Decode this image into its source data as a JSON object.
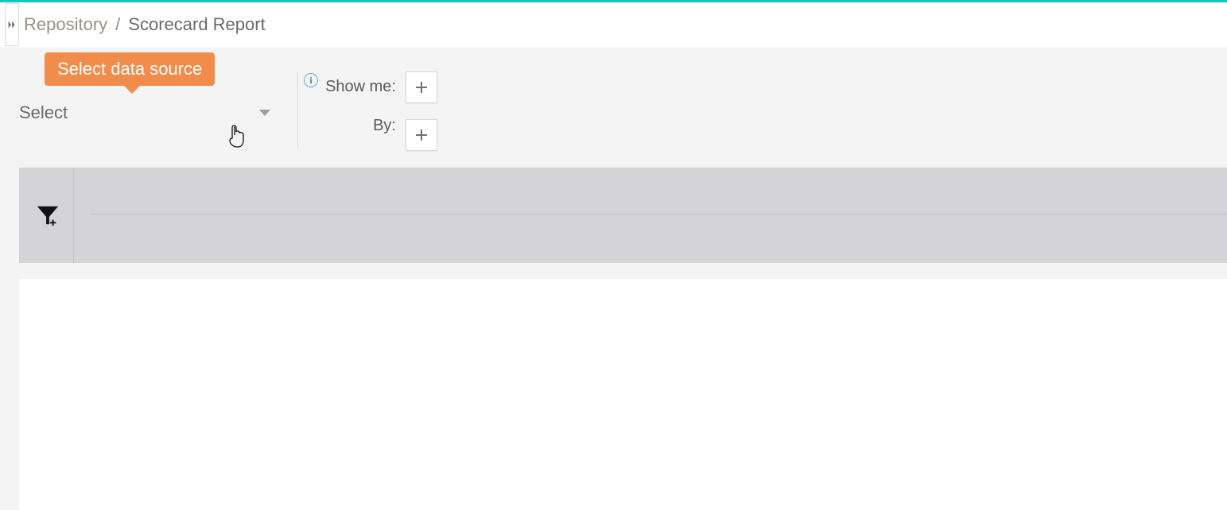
{
  "breadcrumb": {
    "root": "Repository",
    "separator": "/",
    "current": "Scorecard Report"
  },
  "tooltip": {
    "text": "Select data source"
  },
  "dataSource": {
    "placeholder": "Select"
  },
  "query": {
    "showMeLabel": "Show me:",
    "byLabel": "By:"
  },
  "info": {
    "glyph": "i"
  }
}
